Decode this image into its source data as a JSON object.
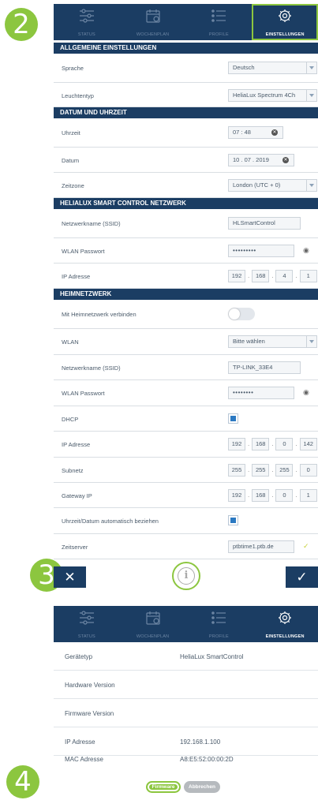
{
  "badges": [
    "2",
    "3",
    "4"
  ],
  "nav": {
    "status": "STATUS",
    "wochenplan": "WOCHENPLAN",
    "profile": "PROFILE",
    "einstellungen": "EINSTELLUNGEN"
  },
  "allgemein": {
    "title": "ALLGEMEINE EINSTELLUNGEN",
    "sprache_label": "Sprache",
    "sprache_value": "Deutsch",
    "leuchtentyp_label": "Leuchtentyp",
    "leuchtentyp_value": "HeliaLux Spectrum 4Ch"
  },
  "datum": {
    "title": "DATUM UND UHRZEIT",
    "uhrzeit_label": "Uhrzeit",
    "uhrzeit_value": "07 : 48",
    "datum_label": "Datum",
    "datum_value": "10 . 07 . 2019",
    "zeitzone_label": "Zeitzone",
    "zeitzone_value": "London (UTC + 0)"
  },
  "netzwerk": {
    "title": "HELIALUX SMART CONTROL NETZWERK",
    "ssid_label": "Netzwerkname (SSID)",
    "ssid_value": "HLSmartControl",
    "pw_label": "WLAN Passwort",
    "pw_value": "•••••••••",
    "ip_label": "IP Adresse",
    "ip": [
      "192",
      "168",
      "4",
      "1"
    ]
  },
  "heim": {
    "title": "HEIMNETZWERK",
    "connect_label": "Mit Heimnetzwerk verbinden",
    "wlan_label": "WLAN",
    "wlan_value": "Bitte wählen",
    "ssid_label": "Netzwerkname (SSID)",
    "ssid_value": "TP-LINK_33E4",
    "pw_label": "WLAN Passwort",
    "pw_value": "••••••••",
    "dhcp_label": "DHCP",
    "ip_label": "IP Adresse",
    "ip": [
      "192",
      "168",
      "0",
      "142"
    ],
    "subnet_label": "Subnetz",
    "subnet": [
      "255",
      "255",
      "255",
      "0"
    ],
    "gateway_label": "Gateway IP",
    "gateway": [
      "192",
      "168",
      "0",
      "1"
    ],
    "auto_label": "Uhrzeit/Datum automatisch beziehen",
    "zeitserver_label": "Zeitserver",
    "zeitserver_value": "ptbtime1.ptb.de"
  },
  "actions": {
    "cancel_glyph": "✕",
    "info_glyph": "i",
    "confirm_glyph": "✓"
  },
  "device": {
    "rows": [
      {
        "label": "Gerätetyp",
        "value": "HeliaLux SmartControl"
      },
      {
        "label": "Hardware Version",
        "value": ""
      },
      {
        "label": "Firmware Version",
        "value": ""
      },
      {
        "label": "IP Adresse",
        "value": "192.168.1.100"
      },
      {
        "label": "MAC Adresse",
        "value": "A8:E5:52:00:00:2D"
      }
    ],
    "firmware_button": "Firmware",
    "abbrechen_button": "Abbrechen"
  },
  "colors": {
    "navy": "#1b3d63",
    "green": "#8cc63f",
    "checkbox_blue": "#2b79c2"
  }
}
